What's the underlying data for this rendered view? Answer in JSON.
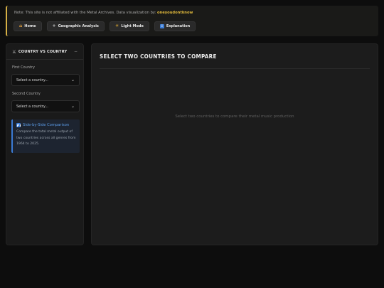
{
  "banner": {
    "note": "Note: This site is not affiliated with the Metal Archives. Data visualization by:",
    "author": "oneyoudontknow"
  },
  "nav": {
    "home": "Home",
    "geo": "Geographic Analysis",
    "light": "Light Mode",
    "explanation": "Explanation"
  },
  "sidebar": {
    "title": "COUNTRY VS COUNTRY",
    "first_label": "First Country",
    "first_value": "Select a country...",
    "second_label": "Second Country",
    "second_value": "Select a country...",
    "info_title": "Side-by-Side Comparison",
    "info_text": "Compare the total metal output of two countries across all genres from 1964 to 2025."
  },
  "main": {
    "title": "SELECT TWO COUNTRIES TO COMPARE",
    "empty": "Select two countries to compare their metal music production"
  },
  "colors": {
    "accent": "#d6b045",
    "info": "#3a7bd5",
    "background": "#0d0d0d"
  }
}
